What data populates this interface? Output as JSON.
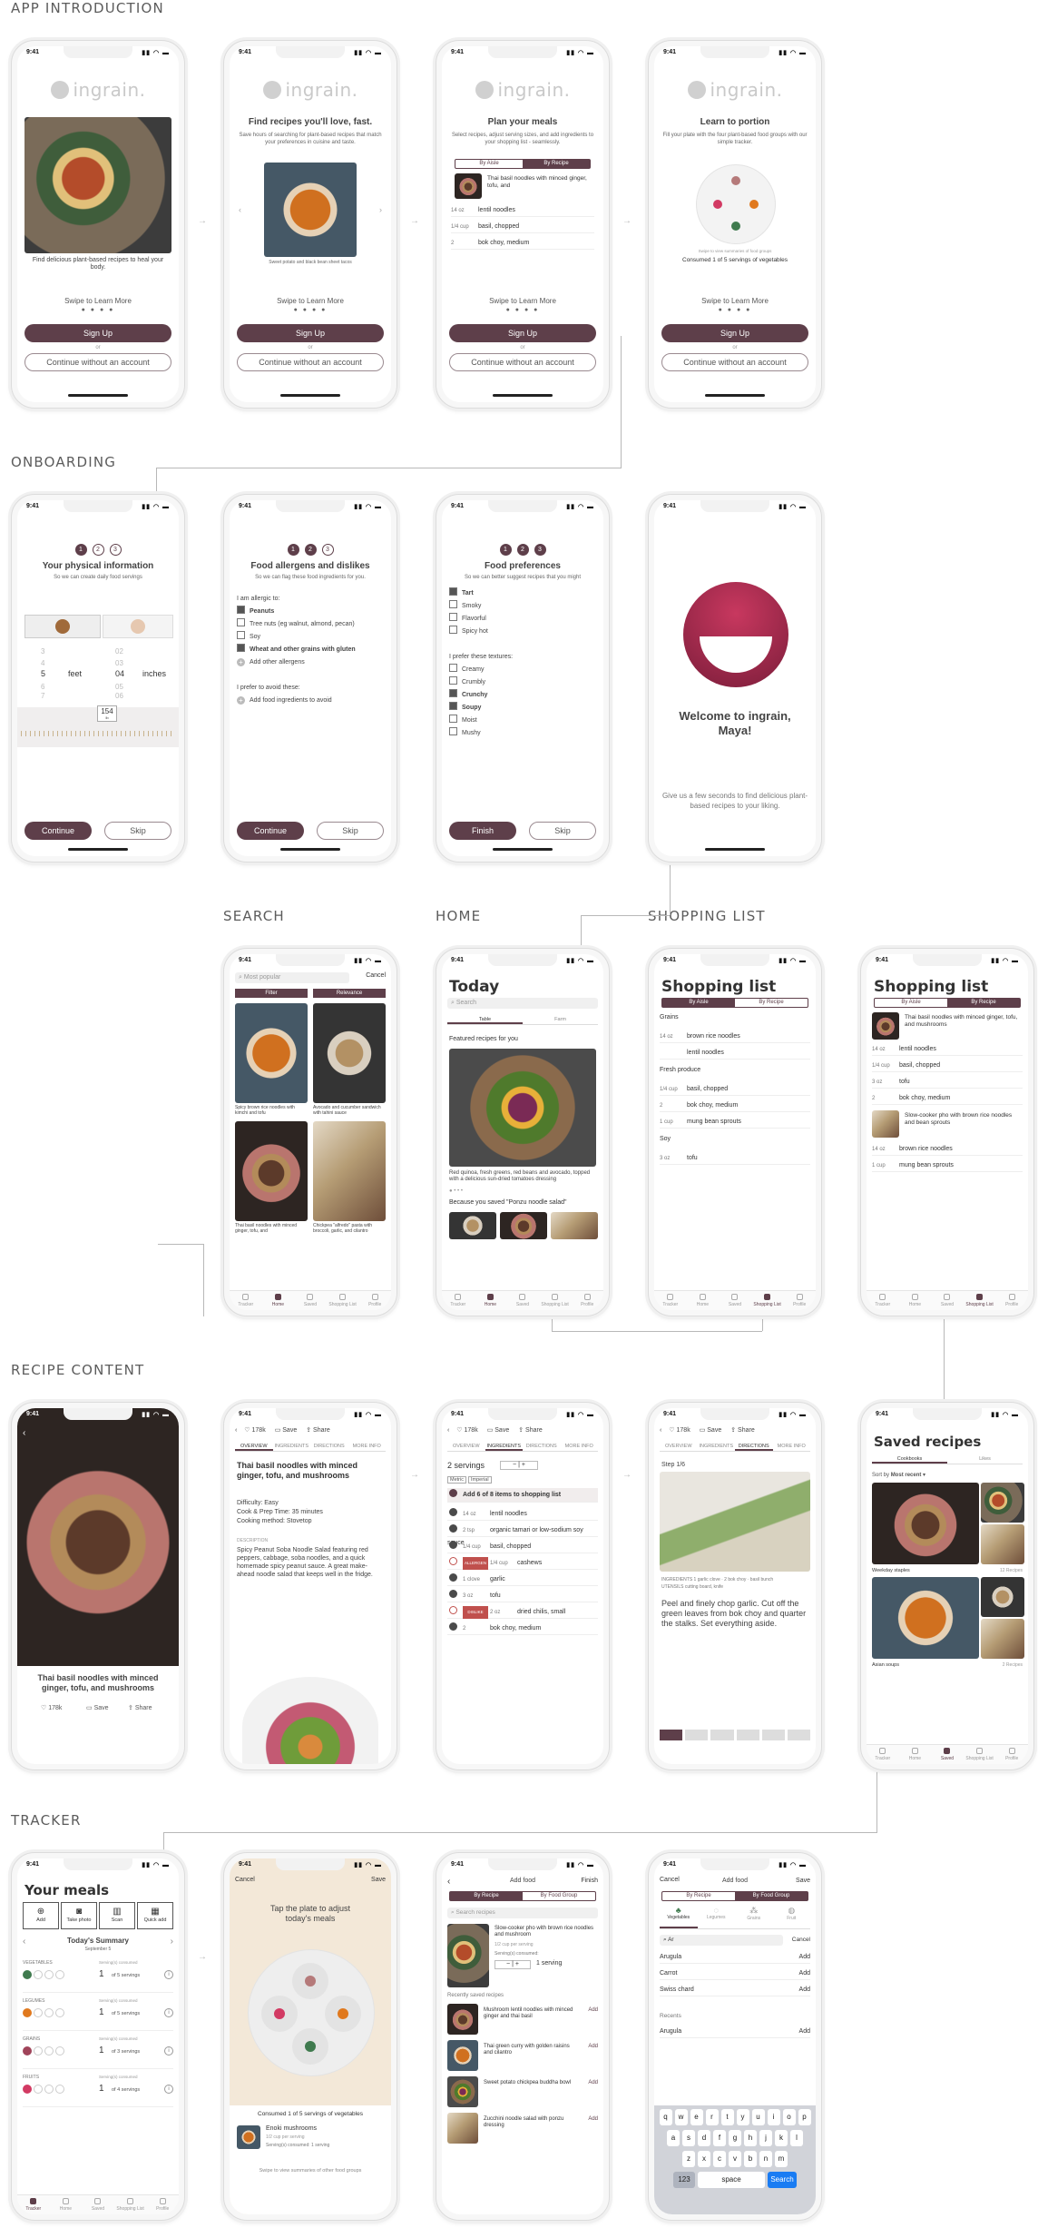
{
  "sections": {
    "intro": "APP INTRODUCTION",
    "onboarding": "ONBOARDING",
    "search": "SEARCH",
    "home": "HOME",
    "shopping": "SHOPPING LIST",
    "recipe": "RECIPE CONTENT",
    "tracker": "TRACKER"
  },
  "status": {
    "time": "9:41"
  },
  "brand": {
    "logo": "ingrain."
  },
  "intro": {
    "swipe": "Swipe to Learn More",
    "dots": "● ● ● ●",
    "signup": "Sign Up",
    "or": "or",
    "continue": "Continue without an account",
    "s1_caption": "Find delicious plant-based recipes to heal your body.",
    "s2_title": "Find recipes you'll love, fast.",
    "s2_desc": "Save hours of searching for plant-based recipes that match your preferences in cuisine and taste.",
    "s2_caption": "Sweet potato and black bean sheet tacos",
    "s3_title": "Plan your meals",
    "s3_desc": "Select recipes, adjust serving sizes, and add ingredients to your shopping list - seamlessly.",
    "s3_tab_aisle": "By Aisle",
    "s3_tab_recipe": "By Recipe",
    "s3_recipe": "Thai basil noodles with minced ginger, tofu, and",
    "s3_rows": [
      {
        "q": "14 oz",
        "n": "lentil noodles"
      },
      {
        "q": "1/4 cup",
        "n": "basil, chopped"
      },
      {
        "q": "2",
        "n": "bok choy, medium"
      }
    ],
    "s4_title": "Learn to portion",
    "s4_desc": "Fill your plate with the four plant-based food groups with our simple tracker.",
    "s4_consumed": "Consumed 1 of 5 servings of vegetables",
    "s4_hint": "Swipe to view summaries of food groups"
  },
  "onboarding": {
    "steps": [
      "1",
      "2",
      "3"
    ],
    "p1_title": "Your physical information",
    "p1_sub": "So we can create daily food servings",
    "p1_rows": [
      {
        "a": "5",
        "b": "feet",
        "c": "04",
        "d": "inches"
      }
    ],
    "p1_weight": "154",
    "p1_unit": "lb",
    "p2_title": "Food allergens and dislikes",
    "p2_sub": "So we can flag these food ingredients for you.",
    "p2_allergic": "I am allergic to:",
    "p2_items": [
      {
        "t": "Peanuts",
        "on": true
      },
      {
        "t": "Tree nuts (eg walnut, almond, pecan)",
        "on": false
      },
      {
        "t": "Soy",
        "on": false
      },
      {
        "t": "Wheat and other grains with gluten",
        "on": true
      }
    ],
    "p2_add": "Add other allergens",
    "p2_avoid": "I prefer to avoid these:",
    "p2_add2": "Add food ingredients to avoid",
    "p3_title": "Food preferences",
    "p3_sub": "So we can better suggest recipes that you might",
    "p3_tastes": [
      {
        "t": "Tart",
        "on": true
      },
      {
        "t": "Smoky",
        "on": false
      },
      {
        "t": "Flavorful",
        "on": false
      },
      {
        "t": "Spicy hot",
        "on": false
      }
    ],
    "p3_textures_label": "I prefer these textures:",
    "p3_textures": [
      {
        "t": "Creamy",
        "on": false
      },
      {
        "t": "Crumbly",
        "on": false
      },
      {
        "t": "Crunchy",
        "on": true
      },
      {
        "t": "Soupy",
        "on": true
      },
      {
        "t": "Moist",
        "on": false
      },
      {
        "t": "Mushy",
        "on": false
      }
    ],
    "continue": "Continue",
    "skip": "Skip",
    "finish": "Finish",
    "welcome": "Welcome to ingrain, Maya!",
    "welcome_sub": "Give us a few seconds to find delicious plant-based recipes to your liking."
  },
  "search": {
    "placeholder": "Most popular",
    "cancel": "Cancel",
    "filter": "Filter",
    "relevance": "Relevance",
    "cards": [
      "Spicy brown rice noodles with kimchi and tofu",
      "Avocado and cucumber sandwich with tahini sauce",
      "Thai basil noodles with minced ginger, tofu, and",
      "Chickpea \"alfredo\" pasta with broccoli, garlic, and cilantro"
    ]
  },
  "home": {
    "title": "Today",
    "search": "Search",
    "tab1": "Table",
    "tab2": "Farm",
    "featured": "Featured recipes for you",
    "desc": "Red quinoa, fresh greens, red beans and avocado, topped with a delicious sun-dried tomatoes dressing",
    "because": "Because you saved \"Ponzu noodle salad\""
  },
  "tabbar": [
    "Tracker",
    "Home",
    "Saved",
    "Shopping List",
    "Profile"
  ],
  "shopping": {
    "title": "Shopping list",
    "aisle": "By Aisle",
    "recipe": "By Recipe",
    "aisle_rows": [
      {
        "h": "Grains"
      },
      {
        "q": "14 oz",
        "n": "brown rice noodles"
      },
      {
        "q": "",
        "n": "lentil noodles"
      },
      {
        "h": "Fresh produce"
      },
      {
        "q": "1/4 cup",
        "n": "basil, chopped"
      },
      {
        "q": "2",
        "n": "bok choy, medium"
      },
      {
        "q": "1 cup",
        "n": "mung bean sprouts"
      },
      {
        "h": "Soy"
      },
      {
        "q": "3 oz",
        "n": "tofu"
      }
    ],
    "recipe_a": "Thai basil noodles with minced ginger, tofu, and mushrooms",
    "recipe_b": "Slow-cooker pho with brown rice noodles and bean sprouts",
    "recipe_rows_a": [
      {
        "q": "14 oz",
        "n": "lentil noodles"
      },
      {
        "q": "1/4 cup",
        "n": "basil, chopped"
      },
      {
        "q": "3 oz",
        "n": "tofu"
      },
      {
        "q": "2",
        "n": "bok choy, medium"
      }
    ],
    "recipe_rows_b": [
      {
        "q": "14 oz",
        "n": "brown rice noodles"
      },
      {
        "q": "1 cup",
        "n": "mung bean sprouts"
      }
    ]
  },
  "recipe": {
    "hero_title": "Thai basil noodles with minced ginger, tofu, and mushrooms",
    "likes": "178k",
    "save": "Save",
    "share": "Share",
    "tabs": [
      "OVERVIEW",
      "INGREDIENTS",
      "DIRECTIONS",
      "MORE INFO"
    ],
    "title": "Thai basil noodles with minced ginger, tofu, and mushrooms",
    "difficulty": "Difficulty: Easy",
    "time": "Cook & Prep Time: 35 minutes",
    "method": "Cooking method: Stovetop",
    "desc_label": "DESCRIPTION",
    "desc": "Spicy Peanut Soba Noodle Salad featuring red peppers, cabbage, soba noodles, and a quick homemade spicy peanut sauce. A great make-ahead noodle salad that keeps well in the fridge.",
    "servings": "2 servings",
    "metric": "Metric",
    "imperial": "Imperial",
    "addall": "Add 6 of 8 items to shopping list",
    "ingredients": [
      {
        "q": "14 oz",
        "n": "lentil noodles",
        "f": ""
      },
      {
        "q": "2 tsp",
        "n": "organic tamari or low-sodium soy sauce",
        "f": ""
      },
      {
        "q": "1/4 cup",
        "n": "basil, chopped",
        "f": ""
      },
      {
        "q": "1/4 cup",
        "n": "cashews",
        "f": "ALLERGEN"
      },
      {
        "q": "1 clove",
        "n": "garlic",
        "f": ""
      },
      {
        "q": "3 oz",
        "n": "tofu",
        "f": ""
      },
      {
        "q": "2 oz",
        "n": "dried chilis, small",
        "f": "DISLIKE"
      },
      {
        "q": "2",
        "n": "bok choy, medium",
        "f": ""
      }
    ],
    "step": "Step 1/6",
    "step_ing": "INGREDIENTS 1 garlic clove · 2 bok choy · basil bunch",
    "step_ut": "UTENSILS cutting board, knife",
    "step_text": "Peel and finely chop garlic. Cut off the green leaves from bok choy and quarter the stalks. Set everything aside.",
    "saved_title": "Saved recipes",
    "cookbooks": "Cookbooks",
    "likes_tab": "Likes",
    "sort": "Sort by",
    "sort_val": "Most recent",
    "weekday": "Weekday staples",
    "weekday_n": "12 Recipes",
    "asian": "Asian soups",
    "asian_n": "2 Recipes"
  },
  "tracker": {
    "title": "Your meals",
    "actions": [
      "Add",
      "Take photo",
      "Scan",
      "Quick add"
    ],
    "summary": "Today's Summary",
    "date": "September 5",
    "groups": [
      {
        "n": "VEGETABLES",
        "v": "1",
        "t": "of 5 servings",
        "c": "#3f7a4e"
      },
      {
        "n": "LEGUMES",
        "v": "1",
        "t": "of 5 servings",
        "c": "#e0791e"
      },
      {
        "n": "GRAINS",
        "v": "1",
        "t": "of 3 servings",
        "c": "#a0445a"
      },
      {
        "n": "FRUITS",
        "v": "1",
        "t": "of 4 servings",
        "c": "#d23a63"
      }
    ],
    "servings_label": "Serving(s) consumed",
    "plate_cancel": "Cancel",
    "plate_save": "Save",
    "plate_title": "Tap the plate to adjust today's meals",
    "plate_consumed": "Consumed 1 of 5 servings of vegetables",
    "plate_food": "Enoki mushrooms",
    "plate_food_sub": "1/2 cup per serving",
    "plate_food_cons": "Serving(s) consumed: 1 serving",
    "plate_hint": "Swipe to view summaries of other food groups",
    "add_title": "Add food",
    "add_finish": "Finish",
    "add_recipe": "By Recipe",
    "add_group": "By Food Group",
    "add_search": "Search recipes",
    "add_item": "Slow-cooker pho with brown rice noodles and mushroom",
    "add_item_sub": "1/2 cup per serving",
    "add_servings": "Serving(s) consumed:",
    "add_serv_val": "1 serving",
    "recent": "Recently saved recipes",
    "recent_items": [
      "Mushroom lentil noodles with minced ginger and thai basil",
      "Thai green curry with golden raisins and cilantro",
      "Sweet potato chickpea buddha bowl",
      "Zucchini noodle salad with ponzu dressing"
    ],
    "add_btn": "Add",
    "fg_tabs": [
      "Vegetables",
      "Legumes",
      "Grains",
      "Fruit"
    ],
    "fg_search": "Ar",
    "fg_cancel": "Cancel",
    "fg_items": [
      "Arugula",
      "Carrot",
      "Swiss chard"
    ],
    "fg_recents": "Recents",
    "fg_recent_item": "Arugula",
    "kb": [
      [
        "q",
        "w",
        "e",
        "r",
        "t",
        "y",
        "u",
        "i",
        "o",
        "p"
      ],
      [
        "a",
        "s",
        "d",
        "f",
        "g",
        "h",
        "j",
        "k",
        "l"
      ],
      [
        "z",
        "x",
        "c",
        "v",
        "b",
        "n",
        "m"
      ]
    ],
    "kb_123": "123",
    "kb_space": "space",
    "kb_search": "Search"
  },
  "colors": {
    "brand": "#5e3f4a",
    "accent": "#a31f4c"
  }
}
